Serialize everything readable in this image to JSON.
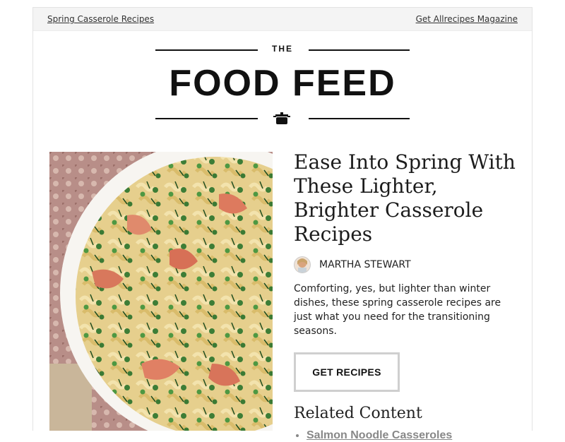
{
  "topbar": {
    "left_link": "Spring Casserole Recipes",
    "right_link": "Get Allrecipes Magazine"
  },
  "logo": {
    "top": "THE",
    "main": "FOOD FEED",
    "icon": "pot-icon"
  },
  "article": {
    "headline": "Ease Into Spring With These Lighter, Brighter Casserole Recipes",
    "author": "MARTHA STEWART",
    "description": "Comforting, yes, but lighter than winter dishes, these spring casserole recipes are just what you need for the transitioning seasons.",
    "button_label": "GET RECIPES",
    "image": "casserole pasta with salmon and peas photo"
  },
  "related": {
    "title": "Related Content",
    "items": [
      "Salmon Noodle Casseroles"
    ]
  },
  "colors": {
    "text": "#222222",
    "link_gray": "#888888",
    "button_border": "#cfcfcf",
    "topbar_bg": "#f4f4f4"
  }
}
